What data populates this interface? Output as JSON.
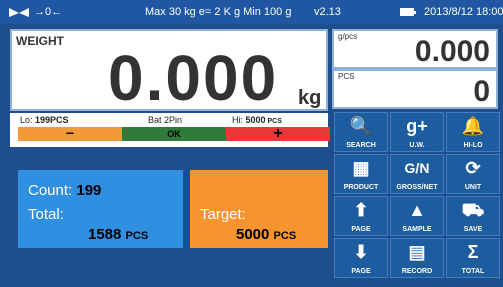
{
  "status": {
    "arrows": "→0←",
    "info": "Max 30 kg  e= 2 K g  Min 100 g",
    "version": "v2.13",
    "datetime": "2013/8/12  18:00"
  },
  "weight": {
    "label": "WEIGHT",
    "value": "0.000",
    "unit": "kg"
  },
  "unit_weight": {
    "label": "g/pcs",
    "value": "0.000"
  },
  "pcs": {
    "label": "PCS",
    "value": "0"
  },
  "limits": {
    "lo_prefix": "Lo: ",
    "lo_value": "199PCS",
    "bat": "Bat 2Pin",
    "hi_prefix": "Hi: ",
    "hi_value": "5000",
    "hi_unit": " PCS",
    "lo_symbol": "−",
    "ok": "OK",
    "hi_symbol": "+"
  },
  "count": {
    "count_label": "Count:",
    "count_value": "199",
    "total_label": "Total:",
    "total_value": "1588",
    "total_unit": "PCS"
  },
  "target": {
    "label": "Target:",
    "value": "5000",
    "unit": "PCS"
  },
  "buttons": [
    {
      "label": "SEARCH",
      "icon": "search-icon"
    },
    {
      "label": "U.W.",
      "icon": "g-plus-icon"
    },
    {
      "label": "HI-LO",
      "icon": "bell-icon"
    },
    {
      "label": "PRODUCT",
      "icon": "boxes-icon"
    },
    {
      "label": "GROSS/NET",
      "icon": "gn-icon"
    },
    {
      "label": "UNIT",
      "icon": "refresh-icon"
    },
    {
      "label": "PAGE",
      "icon": "arrow-up-icon"
    },
    {
      "label": "SAMPLE",
      "icon": "pyramid-icon"
    },
    {
      "label": "SAVE",
      "icon": "save-icon"
    },
    {
      "label": "PAGE",
      "icon": "arrow-down-icon"
    },
    {
      "label": "RECORD",
      "icon": "notebook-icon"
    },
    {
      "label": "TOTAL",
      "icon": "sigma-icon"
    }
  ],
  "button_glyphs": {
    "search": "🔍",
    "uw": "g+",
    "hilo": "🔔",
    "product": "▦",
    "gn": "G/N",
    "unit": "⟳",
    "page_up": "⬆",
    "sample": "▲",
    "save": "⛟",
    "page_down": "⬇",
    "record": "▤",
    "total": "Σ"
  },
  "colors": {
    "background": "#1f4e8c",
    "count_box": "#2f8fe0",
    "target_box": "#f6942f",
    "lo": "#f29a3a",
    "ok": "#2f7b3a",
    "hi": "#e83838"
  }
}
